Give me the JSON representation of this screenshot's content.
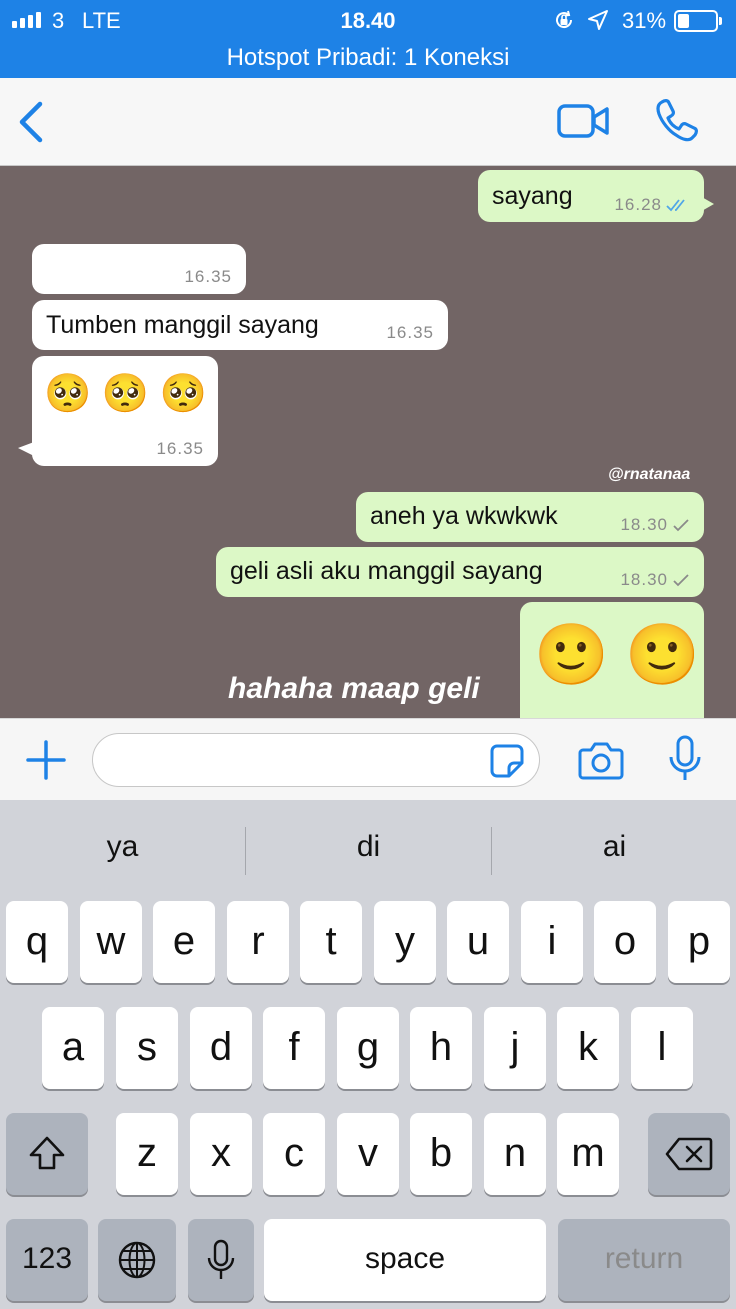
{
  "status_bar": {
    "carrier": "3",
    "network": "LTE",
    "time": "18.40",
    "battery_percent": "31%",
    "battery_level": 0.31,
    "hotspot": "Hotspot Pribadi: 1 Koneksi",
    "color": "#1e82e6"
  },
  "nav": {
    "accent": "#1e82e6"
  },
  "chat": {
    "background": "#726565",
    "messages": [
      {
        "dir": "out",
        "text": "sayang",
        "time": "16.28",
        "status": "read"
      },
      {
        "dir": "in",
        "text": "",
        "time": "16.35"
      },
      {
        "dir": "in",
        "text": "Tumben manggil sayang",
        "time": "16.35"
      },
      {
        "dir": "in",
        "text": "🥺 🥺 🥺",
        "time": "16.35"
      },
      {
        "dir": "out",
        "text": "aneh ya wkwkwk",
        "time": "18.30",
        "status": "sent"
      },
      {
        "dir": "out",
        "text": "geli asli aku manggil sayang",
        "time": "18.30",
        "status": "sent"
      },
      {
        "dir": "out",
        "text": "🙂 🙂",
        "time": "",
        "status": "sent"
      }
    ],
    "watermark": "@rnatanaa",
    "overlay_caption": "hahaha maap geli"
  },
  "input_bar": {
    "placeholder": ""
  },
  "keyboard": {
    "suggestions": [
      "ya",
      "di",
      "ai"
    ],
    "row1": [
      "q",
      "w",
      "e",
      "r",
      "t",
      "y",
      "u",
      "i",
      "o",
      "p"
    ],
    "row2": [
      "a",
      "s",
      "d",
      "f",
      "g",
      "h",
      "j",
      "k",
      "l"
    ],
    "row3": [
      "z",
      "x",
      "c",
      "v",
      "b",
      "n",
      "m"
    ],
    "numbers_label": "123",
    "space_label": "space",
    "return_label": "return"
  }
}
